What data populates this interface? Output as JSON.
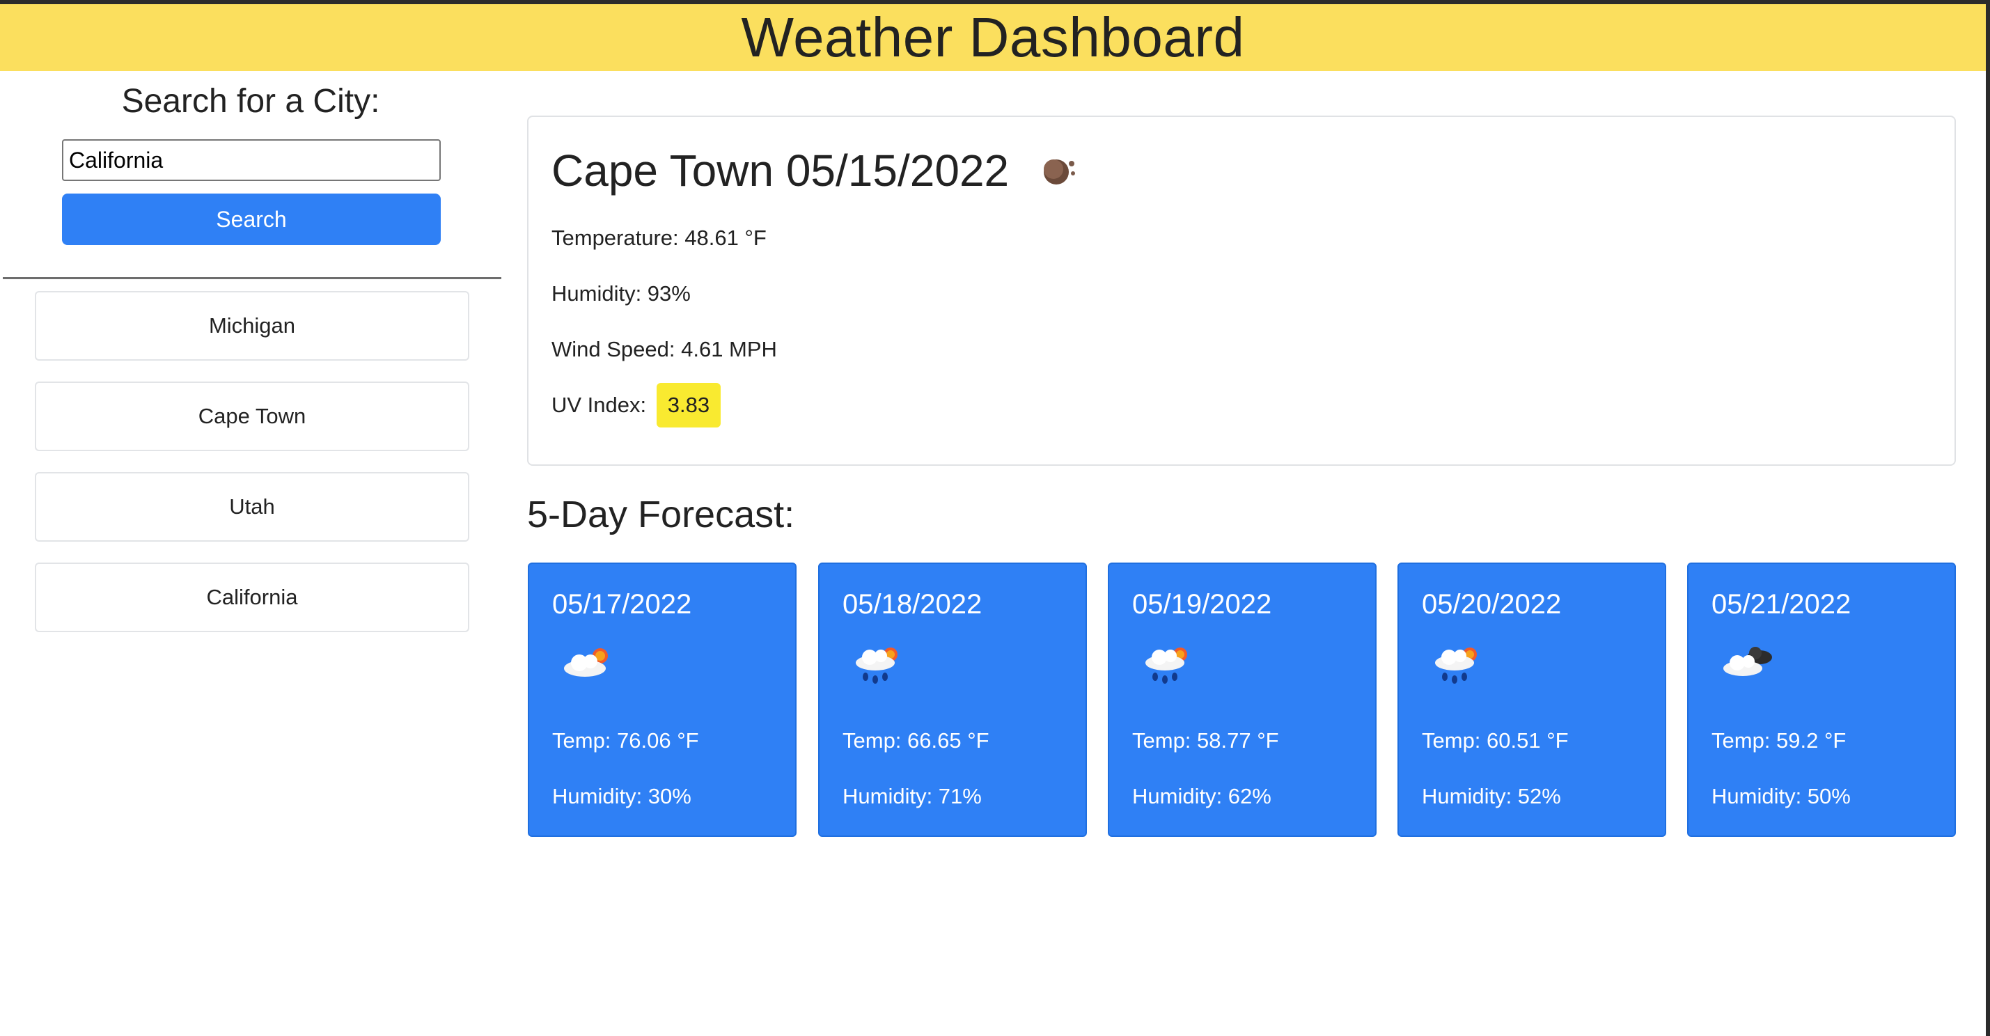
{
  "header": {
    "title": "Weather Dashboard"
  },
  "search": {
    "title": "Search for a City:",
    "input_value": "California",
    "button_label": "Search"
  },
  "history": [
    "Michigan",
    "Cape Town",
    "Utah",
    "California"
  ],
  "current": {
    "title": "Cape Town 05/15/2022",
    "icon": "moon-night-icon",
    "temperature": "Temperature: 48.61 °F",
    "humidity": "Humidity: 93%",
    "wind": "Wind Speed: 4.61 MPH",
    "uv_label": "UV Index:",
    "uv_value": "3.83",
    "uv_color": "#f9ea30"
  },
  "forecast": {
    "title": "5-Day Forecast:",
    "card_color": "#2f80f5",
    "days": [
      {
        "date": "05/17/2022",
        "icon": "cloud-sun-icon",
        "temp": "Temp: 76.06 °F",
        "humidity": "Humidity: 30%"
      },
      {
        "date": "05/18/2022",
        "icon": "rain-sun-icon",
        "temp": "Temp: 66.65 °F",
        "humidity": "Humidity: 71%"
      },
      {
        "date": "05/19/2022",
        "icon": "rain-sun-icon",
        "temp": "Temp: 58.77 °F",
        "humidity": "Humidity: 62%"
      },
      {
        "date": "05/20/2022",
        "icon": "rain-sun-icon",
        "temp": "Temp: 60.51 °F",
        "humidity": "Humidity: 52%"
      },
      {
        "date": "05/21/2022",
        "icon": "cloud-night-icon",
        "temp": "Temp: 59.2 °F",
        "humidity": "Humidity: 50%"
      }
    ]
  }
}
